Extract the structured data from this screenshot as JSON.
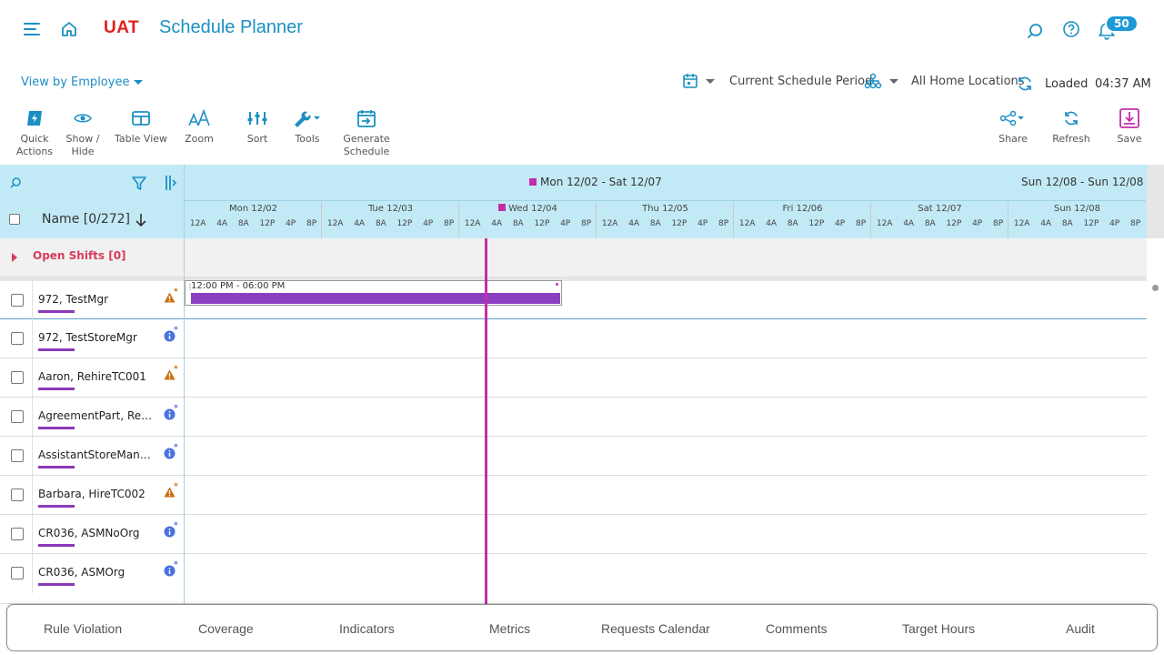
{
  "header": {
    "env": "UAT",
    "title": "Schedule Planner",
    "notifications": "50"
  },
  "filters": {
    "view_by": "View by Employee",
    "period": "Current Schedule Period",
    "locations": "All Home Locations",
    "status": "Loaded",
    "time": "04:37 AM"
  },
  "toolbar": {
    "quick_actions": "Quick Actions",
    "show_hide": "Show / Hide",
    "table_view": "Table View",
    "zoom": "Zoom",
    "sort": "Sort",
    "tools": "Tools",
    "generate": "Generate Schedule",
    "share": "Share",
    "refresh": "Refresh",
    "save": "Save"
  },
  "grid": {
    "week1": "Mon 12/02 - Sat 12/07",
    "week2": "Sun 12/08 - Sun 12/08",
    "name_header": "Name [0/272]",
    "days": [
      "Mon 12/02",
      "Tue 12/03",
      "Wed 12/04",
      "Thu 12/05",
      "Fri 12/06",
      "Sat 12/07",
      "Sun 12/08"
    ],
    "hours": [
      "12A",
      "4A",
      "8A",
      "12P",
      "4P",
      "8P"
    ],
    "open_shifts": "Open Shifts [0]",
    "employees": [
      {
        "name": "972, TestMgr",
        "indicator": "warning"
      },
      {
        "name": "972, TestStoreMgr",
        "indicator": "info"
      },
      {
        "name": "Aaron, RehireTC001",
        "indicator": "warning"
      },
      {
        "name": "AgreementPart, Reg...",
        "indicator": "info"
      },
      {
        "name": "AssistantStoreMana...",
        "indicator": "info"
      },
      {
        "name": "Barbara, HireTC002",
        "indicator": "warning"
      },
      {
        "name": "CR036, ASMNoOrg",
        "indicator": "info"
      },
      {
        "name": "CR036, ASMOrg",
        "indicator": "info"
      }
    ],
    "shift_label": "12:00 PM - 06:00 PM"
  },
  "tabs": [
    "Rule Violation",
    "Coverage",
    "Indicators",
    "Metrics",
    "Requests Calendar",
    "Comments",
    "Target Hours",
    "Audit"
  ],
  "colors": {
    "accent": "#1b8fc4",
    "header_bg": "#c2eaf6",
    "now_line": "#c22ea9",
    "shift": "#8b3ebf",
    "warning": "#c7700e",
    "info": "#4a72e0"
  }
}
